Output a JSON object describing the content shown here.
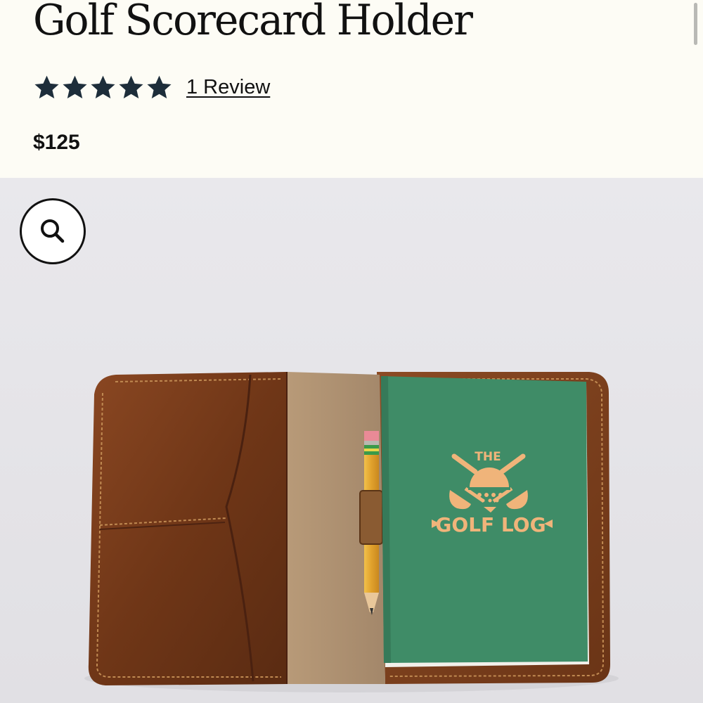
{
  "product": {
    "title": "Golf Scorecard Holder",
    "rating": {
      "value": 5,
      "max": 5,
      "review_link": "1 Review"
    },
    "price": "$125"
  },
  "gallery": {
    "zoom_icon": "magnifier-icon",
    "notebook": {
      "cover_top": "THE",
      "cover_title": "GOLF LOG",
      "cover_color": "#3f8c67",
      "print_color": "#f0b47a"
    },
    "leather_color": "#7a3c1a"
  },
  "colors": {
    "background": "#fdfcf5",
    "text": "#111111",
    "star": "#1d2d3a"
  }
}
